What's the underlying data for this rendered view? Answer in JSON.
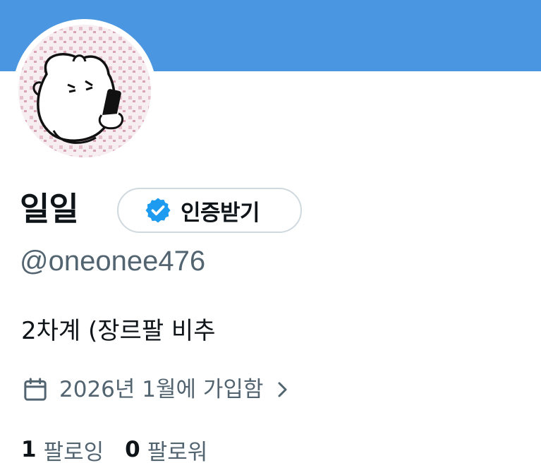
{
  "colors": {
    "banner": "#4a96e0",
    "verified_blue": "#1d9bf0",
    "secondary_text": "#536471",
    "primary_text": "#0f1419",
    "pill_border": "#cfd9de"
  },
  "profile": {
    "display_name": "일일",
    "handle": "@oneonee476",
    "bio": "2차계 (장르팔 비추",
    "verify_button_label": "인증받기",
    "joined_text": "2026년 1월에 가입함",
    "icons": {
      "verify": "verified-badge-icon",
      "calendar": "calendar-icon",
      "chevron": "chevron-right-icon"
    }
  },
  "stats": {
    "following_count": "1",
    "following_label": "팔로잉",
    "followers_count": "0",
    "followers_label": "팔로워"
  }
}
